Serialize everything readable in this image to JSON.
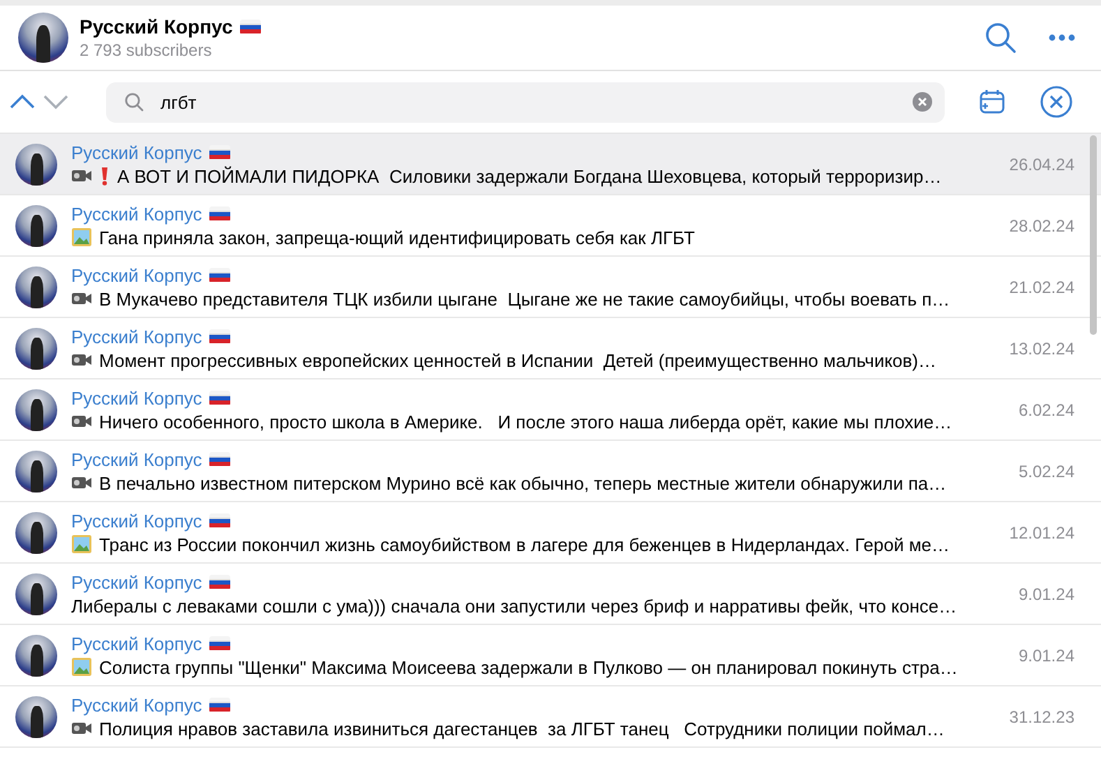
{
  "header": {
    "title": "Русский Корпус",
    "subscribers": "2 793 subscribers"
  },
  "search": {
    "value": "лгбт"
  },
  "results": [
    {
      "name": "Русский Корпус",
      "kind": "video",
      "alert": true,
      "text": "А ВОТ И ПОЙМАЛИ ПИДОРКА  Силовики задержали Богдана Шеховцева, который терроризир…",
      "date": "26.04.24",
      "selected": true
    },
    {
      "name": "Русский Корпус",
      "kind": "photo",
      "alert": false,
      "text": "Гана приняла закон, запреща-ющий идентифицировать себя как ЛГБТ",
      "date": "28.02.24",
      "selected": false
    },
    {
      "name": "Русский Корпус",
      "kind": "video",
      "alert": false,
      "text": "В Мукачево представителя ТЦК избили цыгане  Цыгане же не такие самоубийцы, чтобы воевать п…",
      "date": "21.02.24",
      "selected": false
    },
    {
      "name": "Русский Корпус",
      "kind": "video",
      "alert": false,
      "text": "Момент прогрессивных европейских ценностей в Испании  Детей (преимущественно мальчиков)…",
      "date": "13.02.24",
      "selected": false
    },
    {
      "name": "Русский Корпус",
      "kind": "video",
      "alert": false,
      "text": "Ничего особенного, просто школа в Америке.   И после этого наша либерда орёт, какие мы плохие…",
      "date": "6.02.24",
      "selected": false
    },
    {
      "name": "Русский Корпус",
      "kind": "video",
      "alert": false,
      "text": "В печально известном питерском Мурино всё как обычно, теперь местные жители обнаружили па…",
      "date": "5.02.24",
      "selected": false
    },
    {
      "name": "Русский Корпус",
      "kind": "photo",
      "alert": false,
      "text": "Транс из России покончил жизнь самоубийством в лагере для беженцев в Нидерландах. Герой ме…",
      "date": "12.01.24",
      "selected": false
    },
    {
      "name": "Русский Корпус",
      "kind": "text",
      "alert": false,
      "text": "Либералы с леваками сошли с ума))) сначала они запустили через бриф и нарративы фейк, что консе…",
      "date": "9.01.24",
      "selected": false
    },
    {
      "name": "Русский Корпус",
      "kind": "photo",
      "alert": false,
      "text": "Солиста группы \"Щенки\" Максима Моисеева задержали в Пулково — он планировал покинуть стра…",
      "date": "9.01.24",
      "selected": false
    },
    {
      "name": "Русский Корпус",
      "kind": "video",
      "alert": false,
      "text": "Полиция нравов заставила извиниться дагестанцев  за ЛГБТ танец   Сотрудники полиции поймал…",
      "date": "31.12.23",
      "selected": false
    }
  ]
}
